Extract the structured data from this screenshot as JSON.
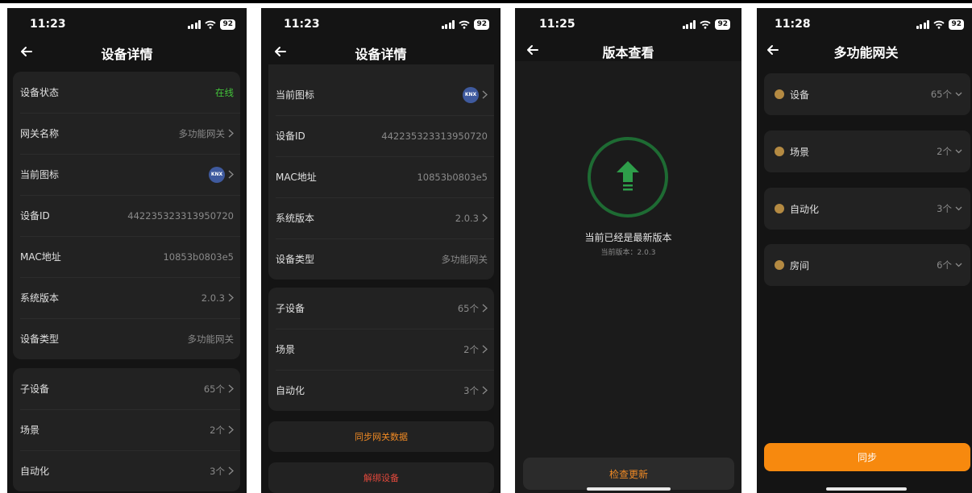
{
  "colors": {
    "background": "#141414",
    "card": "#222222",
    "online": "#43c43a",
    "accent": "#f08a24",
    "danger": "#e2493c",
    "success_ring": "#1e6b33"
  },
  "battery": "92",
  "screen1": {
    "time": "11:23",
    "title": "设备详情",
    "info": [
      {
        "label": "设备状态",
        "value": "在线"
      },
      {
        "label": "网关名称",
        "value": "多功能网关"
      },
      {
        "label": "当前图标",
        "value": "KNX"
      },
      {
        "label": "设备ID",
        "value": "442235323313950720"
      },
      {
        "label": "MAC地址",
        "value": "10853b0803e5"
      },
      {
        "label": "系统版本",
        "value": "2.0.3"
      },
      {
        "label": "设备类型",
        "value": "多功能网关"
      }
    ],
    "sub": [
      {
        "label": "子设备",
        "value": "65个"
      },
      {
        "label": "场景",
        "value": "2个"
      },
      {
        "label": "自动化",
        "value": "3个"
      }
    ]
  },
  "screen2": {
    "time": "11:23",
    "title": "设备详情",
    "info": [
      {
        "label": "当前图标",
        "value": "KNX"
      },
      {
        "label": "设备ID",
        "value": "442235323313950720"
      },
      {
        "label": "MAC地址",
        "value": "10853b0803e5"
      },
      {
        "label": "系统版本",
        "value": "2.0.3"
      },
      {
        "label": "设备类型",
        "value": "多功能网关"
      }
    ],
    "sub": [
      {
        "label": "子设备",
        "value": "65个"
      },
      {
        "label": "场景",
        "value": "2个"
      },
      {
        "label": "自动化",
        "value": "3个"
      }
    ],
    "sync_button": "同步网关数据",
    "unbind_button": "解绑设备"
  },
  "screen3": {
    "time": "11:25",
    "title": "版本查看",
    "status_text": "当前已经是最新版本",
    "version_text": "当前版本：2.0.3",
    "check_button": "检查更新"
  },
  "screen4": {
    "time": "11:28",
    "title": "多功能网关",
    "groups": [
      {
        "label": "设备",
        "value": "65个"
      },
      {
        "label": "场景",
        "value": "2个"
      },
      {
        "label": "自动化",
        "value": "3个"
      },
      {
        "label": "房间",
        "value": "6个"
      }
    ],
    "sync_button": "同步"
  }
}
